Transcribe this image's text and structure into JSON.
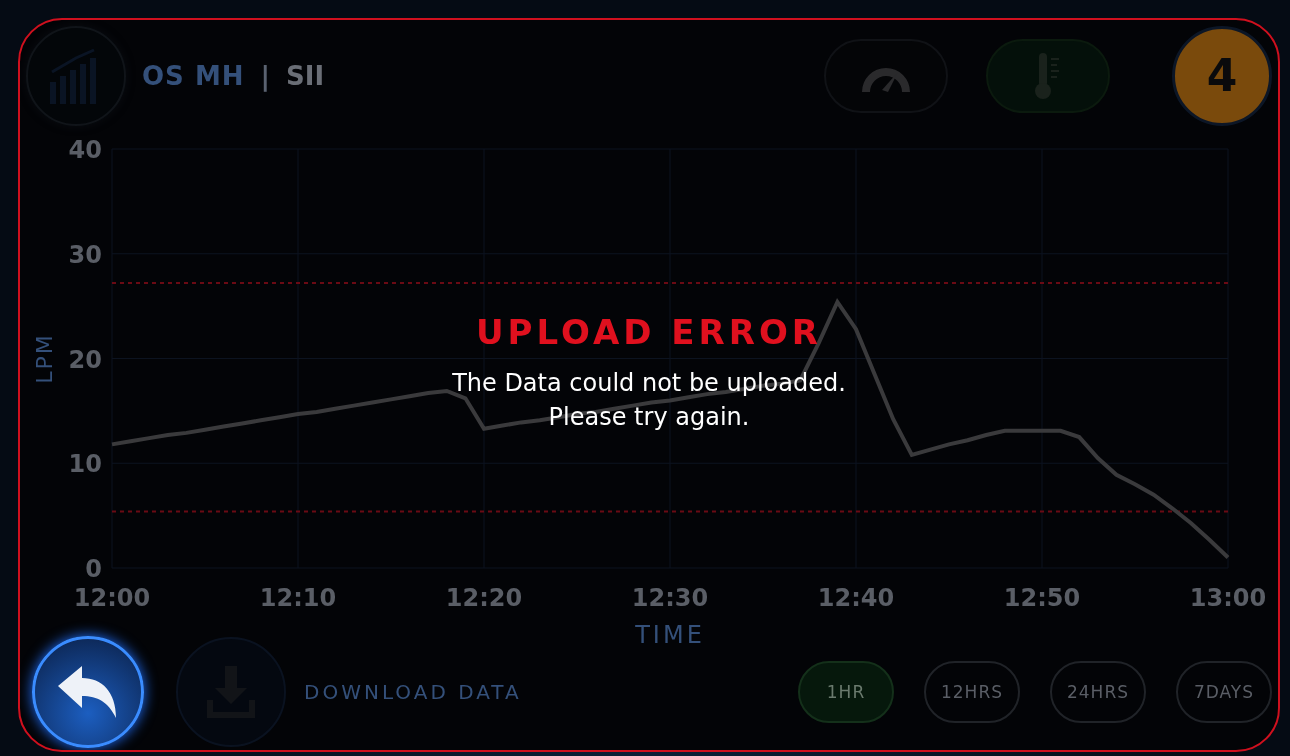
{
  "header": {
    "brand": "OS MH",
    "separator": "|",
    "model": "SII",
    "badge": "4"
  },
  "status_buttons": [
    {
      "kind": "gauge",
      "selected": false
    },
    {
      "kind": "thermometer",
      "selected": true
    }
  ],
  "chart": {
    "chart_data": {
      "type": "line",
      "xlabel": "TIME",
      "ylabel": "LPM",
      "categories": [
        "12:00",
        null,
        null,
        null,
        null,
        null,
        null,
        null,
        null,
        null,
        "12:10",
        null,
        null,
        null,
        null,
        null,
        null,
        null,
        null,
        null,
        "12:20",
        null,
        null,
        null,
        null,
        null,
        null,
        null,
        null,
        null,
        "12:30",
        null,
        null,
        null,
        null,
        null,
        null,
        null,
        null,
        null,
        "12:40",
        null,
        null,
        null,
        null,
        null,
        null,
        null,
        null,
        null,
        "12:50",
        null,
        null,
        null,
        null,
        null,
        null,
        null,
        null,
        null,
        "13:00"
      ],
      "series": [
        {
          "color": "#3a3a3c",
          "values": [
            11.8,
            12.1,
            12.4,
            12.7,
            12.9,
            13.2,
            13.5,
            13.8,
            14.1,
            14.4,
            14.7,
            14.9,
            15.2,
            15.5,
            15.8,
            16.1,
            16.4,
            16.7,
            16.9,
            16.2,
            13.3,
            13.6,
            13.9,
            14.1,
            14.4,
            14.7,
            14.9,
            15.2,
            15.5,
            15.8,
            16.0,
            16.3,
            16.6,
            16.8,
            17.1,
            17.4,
            17.6,
            17.9,
            21.5,
            25.4,
            22.8,
            18.5,
            14.2,
            10.8,
            11.3,
            11.8,
            12.2,
            12.7,
            13.1,
            13.1,
            13.1,
            13.1,
            12.5,
            10.5,
            8.9,
            8.0,
            7.0,
            5.7,
            4.3,
            2.7,
            1.0
          ]
        }
      ],
      "ylim": [
        0,
        40
      ],
      "yticks": [
        0,
        10,
        20,
        30,
        40
      ],
      "grid": true,
      "ref_lines": [
        {
          "axis": "y",
          "value": 27.2,
          "color": "#6a0a14"
        },
        {
          "axis": "y",
          "value": 5.4,
          "color": "#6a0a14"
        }
      ]
    }
  },
  "download": {
    "label": "DOWNLOAD DATA"
  },
  "ranges": [
    {
      "label": "1HR",
      "selected": true
    },
    {
      "label": "12HRS",
      "selected": false
    },
    {
      "label": "24HRS",
      "selected": false
    },
    {
      "label": "7DAYS",
      "selected": false
    }
  ],
  "dialog": {
    "title": "UPLOAD ERROR",
    "message": "The Data could not be uploaded.",
    "hint": "Please try again."
  }
}
